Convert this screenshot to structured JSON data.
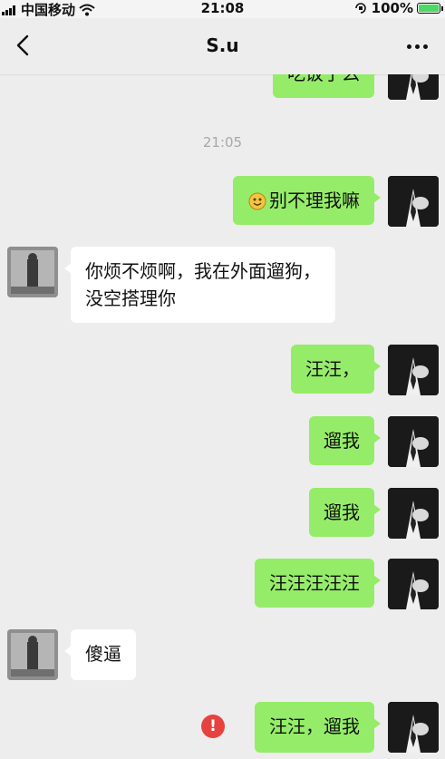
{
  "status_bar": {
    "carrier": "中国移动",
    "time": "21:08",
    "battery_percent": "100%"
  },
  "header": {
    "title": "S.u"
  },
  "messages": [
    {
      "side": "me",
      "text": "吃饭了么"
    },
    {
      "type": "timestamp",
      "text": "21:05"
    },
    {
      "side": "me",
      "text": "别不理我嘛",
      "emoji": "smiling-face-emoji"
    },
    {
      "side": "other",
      "line1": "你烦不烦啊，我在外面遛狗，",
      "line2": "没空搭理你"
    },
    {
      "side": "me",
      "text": "汪汪，"
    },
    {
      "side": "me",
      "text": "遛我"
    },
    {
      "side": "me",
      "text": "遛我"
    },
    {
      "side": "me",
      "text": "汪汪汪汪汪"
    },
    {
      "side": "other",
      "text": "傻逼"
    },
    {
      "side": "me",
      "text": "汪汪，遛我",
      "status": "send-failed",
      "status_glyph": "!"
    }
  ],
  "colors": {
    "my_bubble": "#95ec69",
    "their_bubble": "#ffffff",
    "background": "#ededed",
    "error": "#e64340"
  }
}
